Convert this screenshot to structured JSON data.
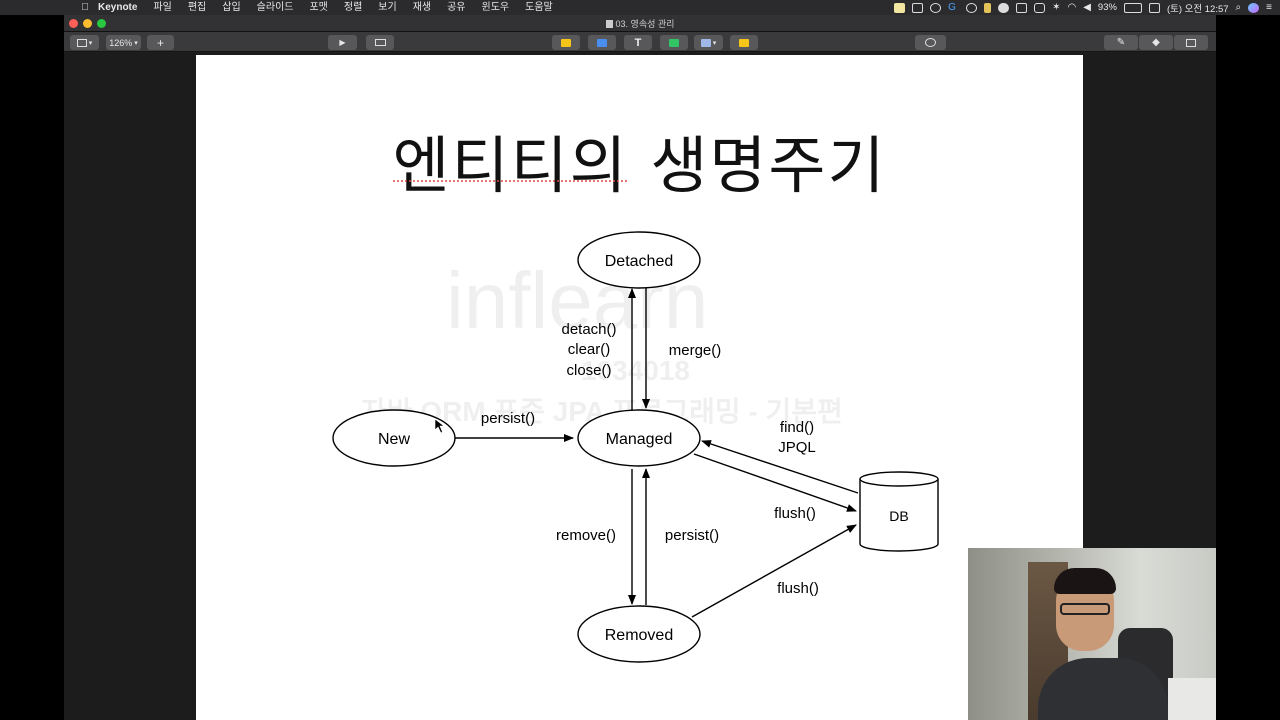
{
  "menubar": {
    "app_name": "Keynote",
    "items": [
      "파일",
      "편집",
      "삽입",
      "슬라이드",
      "포맷",
      "정렬",
      "보기",
      "재생",
      "공유",
      "윈도우",
      "도움말"
    ],
    "battery": "93%",
    "clock": "(토) 오전 12:57"
  },
  "window": {
    "doc_title": "03. 영속성 관리",
    "zoom": "126%",
    "add_symbol": "+"
  },
  "slide": {
    "title": "엔티티의 생명주기",
    "nodes": {
      "detached": "Detached",
      "managed": "Managed",
      "new": "New",
      "removed": "Removed",
      "db": "DB"
    },
    "labels": {
      "detach_lines": [
        "detach()",
        "clear()",
        "close()"
      ],
      "merge": "merge()",
      "persist_new": "persist()",
      "find_lines": [
        "find()",
        "JPQL"
      ],
      "flush_managed": "flush()",
      "remove": "remove()",
      "persist_removed": "persist()",
      "flush_removed": "flush()"
    },
    "watermark": {
      "brand": "inflearn",
      "code": "1034018",
      "course": "자바 ORM 표준 JPA 프로그래밍 - 기본편",
      "name": "김영한"
    }
  },
  "colors": {
    "menubar_bg": "#2b2b2e",
    "toolbar_bg": "#3a3a3c",
    "slide_bg": "#ffffff",
    "stroke": "#000000"
  }
}
